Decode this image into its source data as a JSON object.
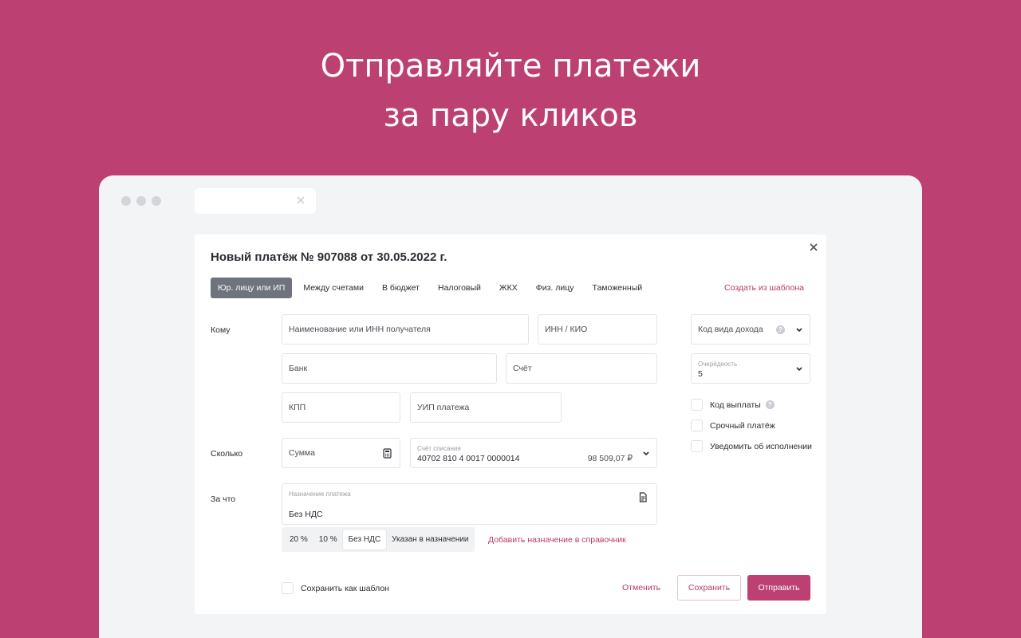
{
  "hero": {
    "line1": "Отправляйте платежи",
    "line2": "за пару кликов"
  },
  "colors": {
    "brand": "#bc4072",
    "accent_text": "#b83a6b",
    "active_tab": "#6f737c",
    "window_bg": "#f3f4f6"
  },
  "dialog": {
    "title": "Новый платёж № 907088 от 30.05.2022 г.",
    "tabs": [
      "Юр. лицу или ИП",
      "Между счетами",
      "В бюджет",
      "Налоговый",
      "ЖКХ",
      "Физ. лицу",
      "Таможенный"
    ],
    "active_tab": "Юр. лицу или ИП",
    "template_link": "Создать из шаблона"
  },
  "form": {
    "to_label": "Кому",
    "amount_label": "Сколько",
    "purpose_label": "За что",
    "recipient_placeholder": "Наименование или ИНН получателя",
    "inn_placeholder": "ИНН / КИО",
    "bank_placeholder": "Банк",
    "account_placeholder": "Счёт",
    "kpp_placeholder": "КПП",
    "uip_placeholder": "УИП платежа",
    "income_code_placeholder": "Код вида дохода",
    "priority_label": "Очерёдность",
    "priority_value": "5",
    "sum_placeholder": "Сумма",
    "debit_account_label": "Счёт списания",
    "debit_account_value": "40702 810 4 0017 0000014",
    "debit_account_balance": "98 509,07 ₽",
    "purpose_field_label": "Назначение платежа",
    "purpose_value": "Без НДС",
    "vat_options": [
      "20 %",
      "10 %",
      "Без НДС",
      "Указан в назначении"
    ],
    "vat_selected": "Без НДС",
    "add_to_directory": "Добавить назначение в справочник"
  },
  "options": {
    "payment_code": "Код выплаты",
    "urgent": "Срочный платёж",
    "notify": "Уведомить об исполнении"
  },
  "footer": {
    "save_template": "Сохранить как шаблон",
    "cancel": "Отменить",
    "save": "Сохранить",
    "send": "Отправить"
  }
}
